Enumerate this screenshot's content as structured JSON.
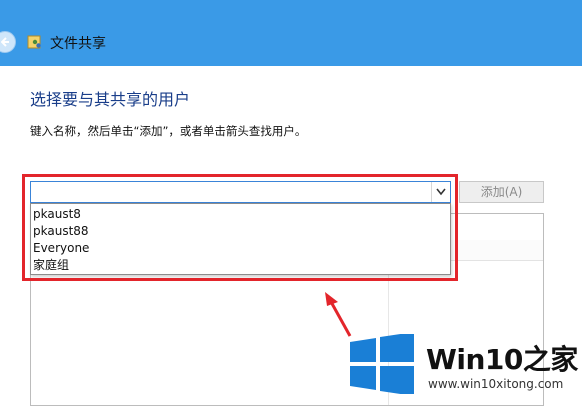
{
  "window": {
    "title": "文件共享",
    "back_icon": "back-arrow-icon",
    "app_icon": "file-sharing-icon"
  },
  "page": {
    "heading": "选择要与其共享的用户",
    "instruction": "键入名称，然后单击“添加”，或者单击箭头查找用户。"
  },
  "combo": {
    "value": "",
    "arrow_icon": "chevron-down-icon"
  },
  "add_button": {
    "label": "添加(A)"
  },
  "dropdown": {
    "options": [
      "pkaust8",
      "pkaust88",
      "Everyone",
      "家庭组"
    ]
  },
  "colors": {
    "titlebar": "#3a9ae7",
    "heading": "#1a3e8a",
    "highlight": "#e3252b",
    "logo": "#1a7fd6"
  },
  "watermark": {
    "brand_text": "Win10之家",
    "url": "www.win10xitong.com"
  }
}
